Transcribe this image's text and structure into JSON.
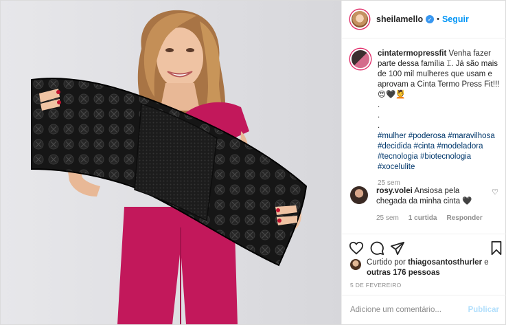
{
  "header": {
    "username": "sheilamello",
    "separator": "•",
    "follow_label": "Seguir",
    "verified_icon": "check-badge-icon"
  },
  "caption": {
    "username": "cintatermopressfit",
    "line1": "Venha fazer parte dessa família ",
    "line2": ". Já são mais de 100 mil mulheres que usam e aprovam a Cinta Termo Press Fit!!! 😍🖤💆",
    "dots": [
      ".",
      ".",
      "."
    ],
    "hashtags": [
      "#mulher",
      "#poderosa",
      "#maravilhosa",
      "#decidida",
      "#cinta",
      "#modeladora",
      "#tecnologia",
      "#biotecnologia",
      "#xocelulite"
    ],
    "time": "25 sem"
  },
  "comment": {
    "username": "rosy.volei",
    "text": "Ansiosa pela chegada da minha cinta 🖤",
    "time": "25 sem",
    "likes": "1 curtida",
    "reply_label": "Responder"
  },
  "likes": {
    "prefix": "Curtido por ",
    "user": "thiagosantosthurler",
    "middle": " e ",
    "others": "outras 176 pessoas"
  },
  "date": "5 DE FEVEREIRO",
  "add_comment": {
    "placeholder": "Adicione um comentário...",
    "publish_label": "Publicar"
  },
  "colors": {
    "link_blue": "#0095f6",
    "hashtag": "#00376b",
    "muted": "#8e8e8e",
    "publish_disabled": "#b2dffc",
    "outfit": "#c2185b"
  }
}
